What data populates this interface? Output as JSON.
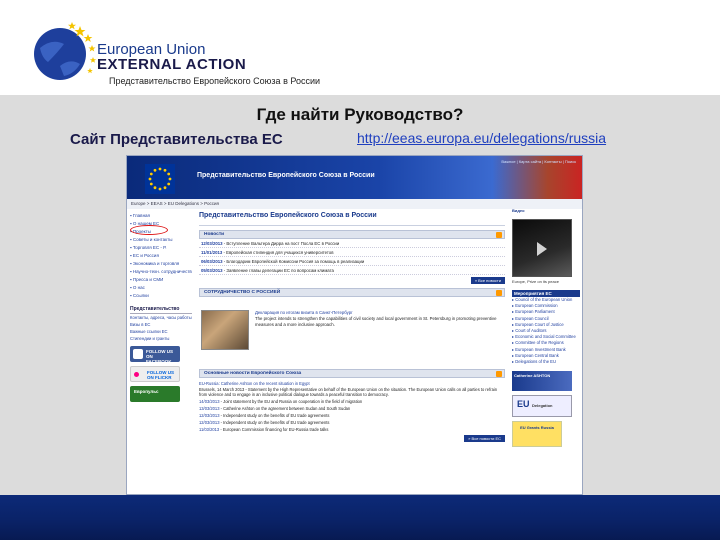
{
  "header": {
    "logo_line1": "European Union",
    "logo_line2": "EXTERNAL ACTION",
    "subtitle": "Представительство Европейского Союза  в России"
  },
  "slide": {
    "heading": "Где найти Руководство?",
    "site_label": "Сайт Представительства ЕС",
    "site_url": "http://eeas.europa.eu/delegations/russia"
  },
  "website": {
    "banner_title": "Представительство Европейского Союза в России",
    "top_links": "Важное | Карта сайта | Контакты | Поиск",
    "breadcrumb": "Europe > EEAS > EU Delegations > Россия",
    "page_title": "Представительство Европейского Союза в России",
    "nav": [
      "Главная",
      "О нашем ЕС",
      "Проекты",
      "Советы и контакты",
      "Торговля ЕС - Р.",
      "ЕС и Россия",
      "Экономика и торговля",
      "Научно-техн. сотрудничество",
      "Пресса и СМИ",
      "О нас",
      "Ссылки"
    ],
    "left_box_title": "Представительство",
    "left_links": [
      "Контакты, адреса, часы работы",
      "Визы в ЕС",
      "Важные ссылки ЕС",
      "Стипендии и гранты"
    ],
    "badges": {
      "facebook": "FOLLOW US ON FACEBOOK",
      "flickr": "FOLLOW US ON FLICKR",
      "evropuls": "Европульс"
    },
    "news_section": "Новости",
    "news": [
      {
        "date": "12/03/2013",
        "text": "- Вступление Вальтера Дирра на пост Посла ЕС в России"
      },
      {
        "date": "11/01/2013",
        "text": "- Европейская стипендия для учащихся университетов"
      },
      {
        "date": "06/03/2013",
        "text": "- Благодарим Европейской Комиссии Россия за помощь в реализации"
      },
      {
        "date": "05/03/2013",
        "text": "- Заявление главы делегации ЕС по вопросам климата"
      }
    ],
    "more_news": "» Все новости",
    "coop_section": "СОТРУДНИЧЕСТВО С РОССИЕЙ",
    "coop_lead": "Декларация по итогам визита в Санкт-Петербург",
    "coop_body": "The project intends to strengthen the capabilities of civil society and local government in St. Petersburg in promoting preventive measures and a more inclusive approach.",
    "main_section": "Основные новости Европейского Союза",
    "main_lead": "EU-Russia: Catherine Ashton on the recent situation in Egypt",
    "main_body": "Brussels, 14 March 2013 - Statement by the High Representative on behalf of the European Union on the situation. The European Union calls on all parties to refrain from violence and to engage in an inclusive political dialogue towards a peaceful transition to democracy.",
    "bullets": [
      {
        "date": "14/03/2013",
        "text": "- Joint statement by the EU and Russia on cooperation in the field of migration"
      },
      {
        "date": "13/03/2013",
        "text": "- Catherine Ashton on the agreement between Sudan and South Sudan"
      },
      {
        "date": "12/03/2013",
        "text": "- Independent study on the benefits of EU trade agreements"
      },
      {
        "date": "12/03/2013",
        "text": "- Independent study on the benefits of EU trade agreements"
      },
      {
        "date": "11/03/2013",
        "text": "- European Commission financing for EU-Russia trade talks"
      }
    ],
    "more_main": "» Все новости ЕС",
    "right": {
      "video_label": "Видео",
      "video_caption": "Europe, Prize on its peace",
      "box_title": "Мероприятия ЕС",
      "links": [
        "Council of the European Union",
        "European Commission",
        "European Parliament",
        "European Council",
        "European Court of Justice",
        "Court of Auditors",
        "Economic and Social Committee",
        "Committee of the Regions",
        "European Investment Bank",
        "European Central Bank",
        "Delegations of the EU"
      ],
      "ashton": "Catherine ASHTON",
      "eu": "EU",
      "eu_small": "Delegation",
      "yellow": "EU Grants Russia"
    }
  }
}
